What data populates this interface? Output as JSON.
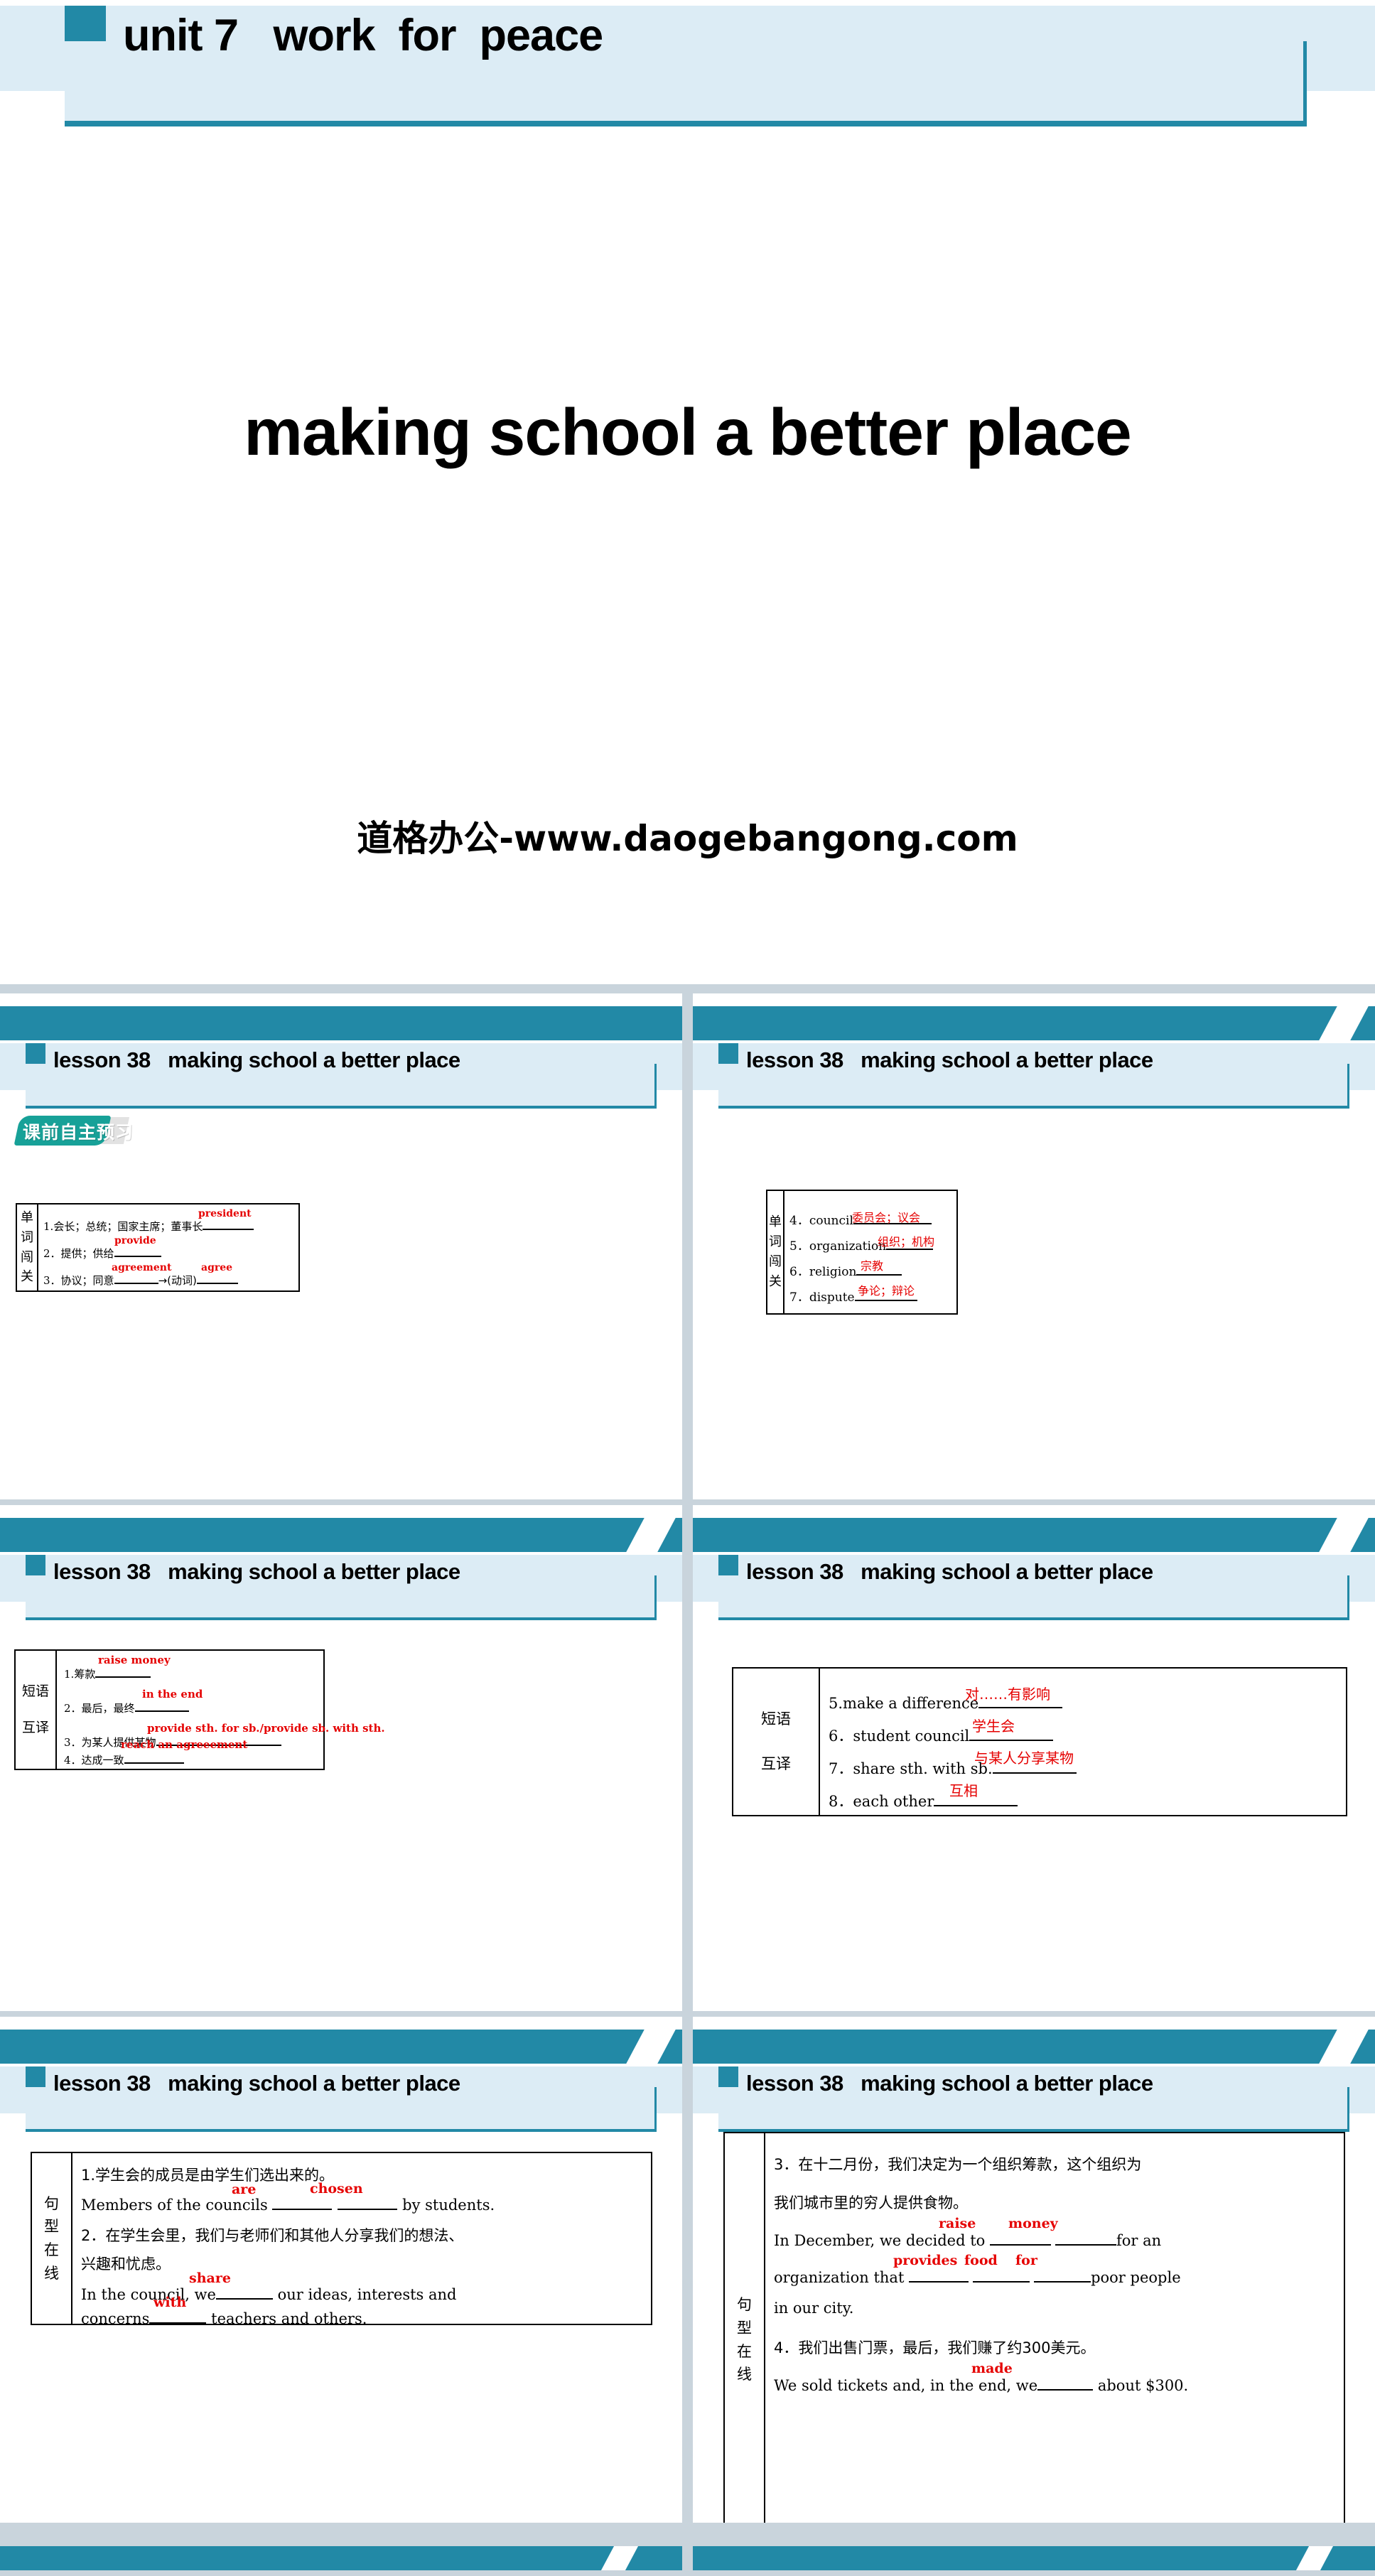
{
  "title_slide": {
    "header": "unit 7   work  for  peace",
    "main_title": "making school a better place",
    "watermark": "道格办公-www.daogebangong.com"
  },
  "theme": {
    "teal": "#2289a6",
    "light_blue": "#dcecf5",
    "answer_red": "#e50000",
    "badge_teal": "#17a198",
    "page_bg": "#c9d4dc"
  },
  "slide_header": "lesson 38   making school a better place",
  "badge_label": "课前自主预习",
  "slides": [
    {
      "id": "words-1",
      "row_label": [
        "单",
        "词",
        "闯",
        "关"
      ],
      "items": [
        {
          "num": "1.",
          "prompt": "会长；总统；国家主席；董事长",
          "answer": "president",
          "answer2": "",
          "mid": ""
        },
        {
          "num": "2．",
          "prompt": "提供；供给",
          "answer": "provide",
          "answer2": "",
          "mid": ""
        },
        {
          "num": "3．",
          "prompt": "协议；同意",
          "answer": "agreement",
          "mid": "→(动词)",
          "answer2": "agree"
        }
      ]
    },
    {
      "id": "words-2",
      "row_label": [
        "单",
        "词",
        "闯",
        "关"
      ],
      "items": [
        {
          "num": "4．",
          "prompt": "council",
          "answer": "委员会；议会"
        },
        {
          "num": "5．",
          "prompt": "organization",
          "answer": "组织；机构"
        },
        {
          "num": "6．",
          "prompt": "religion",
          "answer": "宗教"
        },
        {
          "num": "7．",
          "prompt": "dispute",
          "answer": "争论；辩论"
        }
      ]
    },
    {
      "id": "phrases-1",
      "row_label": [
        "短语",
        "互译"
      ],
      "items": [
        {
          "num": "1.",
          "prompt": "筹款",
          "answer": "raise money"
        },
        {
          "num": "2．",
          "prompt": "最后，最终",
          "answer": "in the end"
        },
        {
          "num": "3．",
          "prompt": "为某人提供某物",
          "answer": "provide sth. for sb./provide sb. with sth."
        },
        {
          "num": "4．",
          "prompt": "达成一致",
          "answer": "reach an agreeement"
        }
      ]
    },
    {
      "id": "phrases-2",
      "row_label": [
        "短语",
        "互译"
      ],
      "items": [
        {
          "num": "5.",
          "prompt": "make a difference",
          "answer": "对……有影响"
        },
        {
          "num": "6．",
          "prompt": "student council",
          "answer": "学生会"
        },
        {
          "num": "7．",
          "prompt": "share sth. with sb.",
          "answer": "与某人分享某物"
        },
        {
          "num": "8．",
          "prompt": "each other",
          "answer": "互相"
        }
      ]
    },
    {
      "id": "sentences-1",
      "row_label": [
        "句",
        "型",
        "在",
        "线"
      ],
      "q1_cn": "1.学生会的成员是由学生们选出来的。",
      "q1_en_a": "Members of the councils ",
      "q1_en_b": " by  students.",
      "q1_ans1": "are",
      "q1_ans2": "chosen",
      "q2_cn_l1": "2．在学生会里，我们与老师们和其他人分享我们的想法、",
      "q2_cn_l2": "兴趣和忧虑。",
      "q2_en_a": "In the council, we",
      "q2_en_b": " our ideas, interests and",
      "q2_en_c": "concerns",
      "q2_en_d": " teachers and others.",
      "q2_ans1": "share",
      "q2_ans2": "with"
    },
    {
      "id": "sentences-2",
      "row_label": [
        "句",
        "型",
        "在",
        "线"
      ],
      "q3_cn_l1": "3．在十二月份，我们决定为一个组织筹款，这个组织为",
      "q3_cn_l2": "我们城市里的穷人提供食物。",
      "q3_en_a": "In December, we decided to ",
      "q3_en_b": "for an",
      "q3_en_c": "organization that ",
      "q3_en_d": "poor people",
      "q3_en_e": "in our city.",
      "q3_ans1": "raise",
      "q3_ans2": "money",
      "q3_ans3": "provides",
      "q3_ans4": "food",
      "q3_ans5": "for",
      "q4_cn": "4．我们出售门票，最后，我们赚了约300美元。",
      "q4_en_a": "We sold tickets and, in the end, we",
      "q4_en_b": " about $300.",
      "q4_ans1": "made"
    }
  ]
}
